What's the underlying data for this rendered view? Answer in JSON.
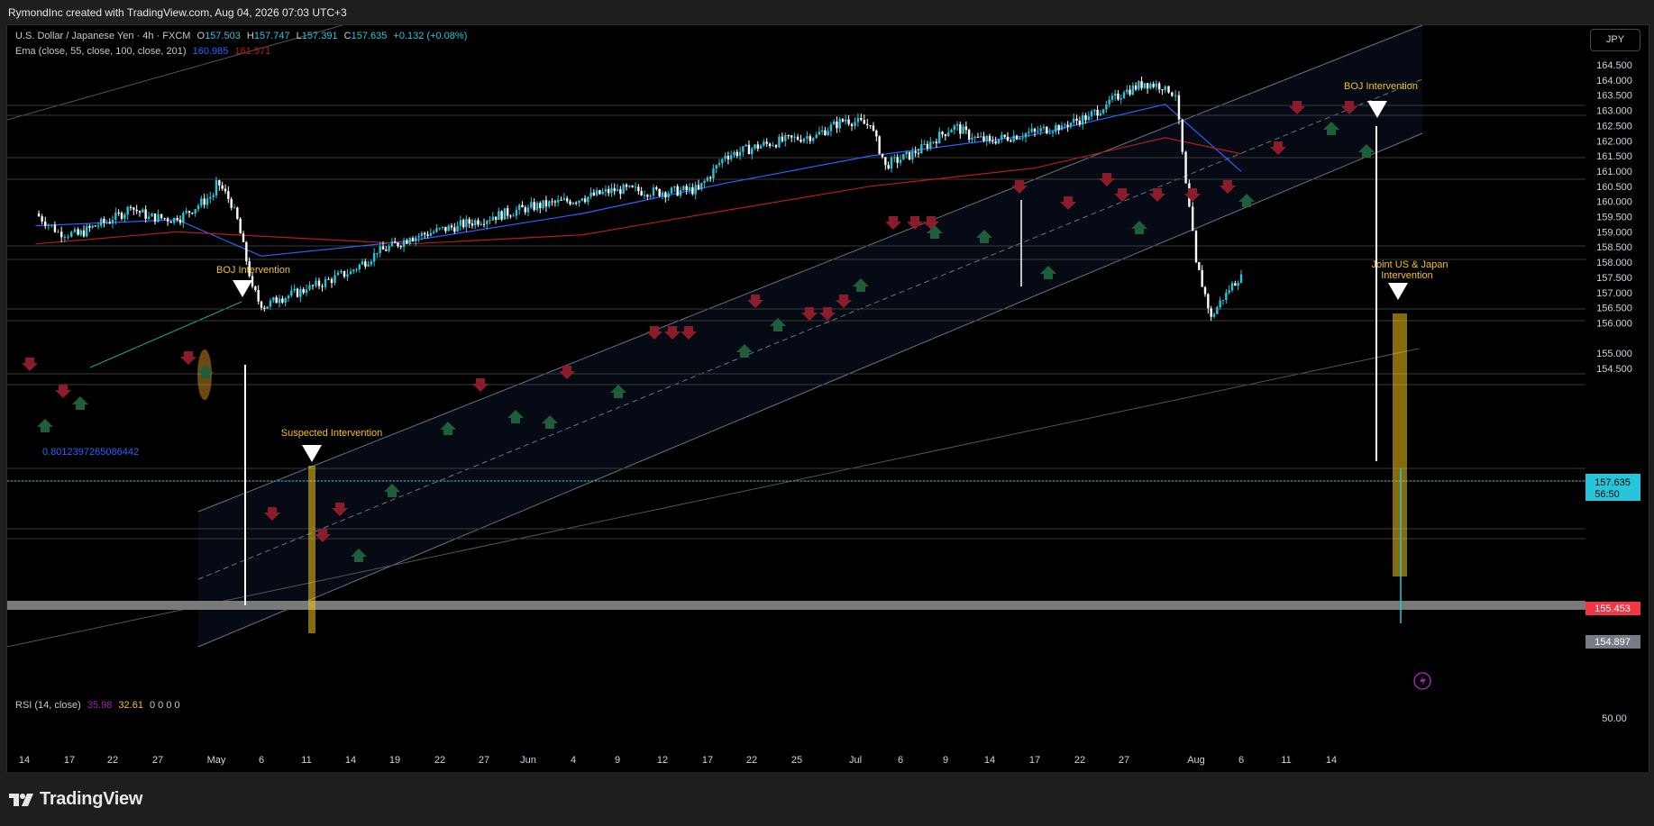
{
  "header": {
    "attribution": "RymondInc created with TradingView.com, Aug 04, 2026 07:03 UTC+3"
  },
  "legend": {
    "symbol": "U.S. Dollar / Japanese Yen · 4h · FXCM",
    "o_label": "O",
    "o_value": "157.503",
    "h_label": "H",
    "h_value": "157.747",
    "l_label": "L",
    "l_value": "157.391",
    "c_label": "C",
    "c_value": "157.635",
    "change": "+0.132 (+0.08%)",
    "ema_label": "Ema (close, 55, close, 100, close, 201)",
    "ema_value_1": "160.985",
    "ema_value_2": "161.571",
    "rsi_label": "RSI (14, close)",
    "rsi_value_1": "35.98",
    "rsi_value_2": "32.61",
    "rsi_zeros": "0  0  0  0"
  },
  "currency_button": "JPY",
  "price_badge": {
    "price": "157.635",
    "countdown": "56:50"
  },
  "level_labels": {
    "support": "155.453",
    "low": "154.897"
  },
  "annotations": {
    "boj_1": "BOJ Intervention",
    "suspected": "Suspected Intervention",
    "boj_2": "BOJ Intervention",
    "joint_line1": "Joint US & Japan",
    "joint_line2": "Intervention",
    "fib_value": "0.8012397265086442"
  },
  "rsi_signals": [
    "Bear",
    "Bear",
    "Bull",
    "Bear",
    "Bear",
    "Bear",
    "Bear",
    "Bull",
    "Bear",
    "Bull"
  ],
  "rsi_axis_label": "50.00",
  "brand": "TradingView",
  "colors": {
    "accent": "#26c6da",
    "bear": "#f23645",
    "bull": "#4caf50",
    "annotation": "#f0c419",
    "ema_fast": "#2962ff",
    "ema_slow": "#b71c1c",
    "background": "#000000"
  },
  "chart_data": {
    "type": "line",
    "title": "U.S. Dollar / Japanese Yen · 4h · FXCM",
    "y_ticks": [
      "164.500",
      "164.000",
      "163.500",
      "163.000",
      "162.500",
      "162.000",
      "161.500",
      "161.000",
      "160.500",
      "160.000",
      "159.500",
      "159.000",
      "158.500",
      "158.000",
      "157.500",
      "157.000",
      "156.500",
      "156.000",
      "155.000",
      "154.500"
    ],
    "ylim": [
      154.2,
      164.9
    ],
    "x_ticks": [
      "14",
      "17",
      "22",
      "27",
      "May",
      "6",
      "11",
      "14",
      "19",
      "22",
      "27",
      "Jun",
      "4",
      "9",
      "12",
      "17",
      "22",
      "25",
      "Jul",
      "6",
      "9",
      "14",
      "17",
      "22",
      "27",
      "Aug",
      "6",
      "11",
      "14"
    ],
    "series": [
      {
        "name": "USDJPY",
        "x": [
          "Apr 14",
          "Apr 16",
          "Apr 18",
          "Apr 20",
          "Apr 22",
          "Apr 24",
          "Apr 26",
          "Apr 28",
          "Apr 30",
          "May 1",
          "May 3",
          "May 5",
          "May 6",
          "May 8",
          "May 11",
          "May 14",
          "May 17",
          "May 20",
          "May 24",
          "May 28",
          "Jun 1",
          "Jun 5",
          "Jun 9",
          "Jun 12",
          "Jun 16",
          "Jun 19",
          "Jun 23",
          "Jun 27",
          "Jun 30",
          "Jul 2",
          "Jul 3",
          "Jul 5",
          "Jul 8",
          "Jul 10",
          "Jul 12",
          "Jul 15",
          "Jul 18",
          "Jul 21",
          "Jul 23",
          "Jul 25",
          "Jul 27",
          "Jul 29",
          "Jul 30",
          "Jul 31",
          "Aug 1",
          "Aug 2",
          "Aug 3",
          "Aug 4"
        ],
        "values": [
          159.6,
          159.0,
          158.9,
          159.2,
          159.4,
          159.8,
          159.5,
          159.4,
          160.3,
          160.7,
          159.8,
          157.2,
          156.5,
          156.8,
          157.1,
          157.7,
          158.3,
          158.8,
          159.2,
          159.5,
          159.8,
          160.1,
          160.4,
          160.3,
          160.4,
          161.5,
          161.9,
          162.2,
          162.7,
          162.5,
          161.2,
          161.6,
          162.5,
          162.1,
          162.0,
          162.3,
          162.5,
          162.8,
          163.2,
          163.6,
          163.9,
          163.8,
          163.5,
          160.6,
          158.0,
          156.2,
          157.0,
          157.6
        ]
      },
      {
        "name": "EMA 55",
        "x": [
          "Apr 14",
          "Apr 28",
          "May 6",
          "May 20",
          "Jun 5",
          "Jun 19",
          "Jul 2",
          "Jul 15",
          "Jul 29",
          "Aug 4"
        ],
        "values": [
          159.2,
          159.4,
          158.2,
          158.7,
          159.6,
          160.6,
          161.5,
          162.2,
          163.2,
          160.99
        ]
      },
      {
        "name": "EMA 100",
        "x": [
          "Apr 14",
          "Apr 28",
          "May 20",
          "Jun 5",
          "Jun 19",
          "Jul 2",
          "Jul 15",
          "Jul 29",
          "Aug 4"
        ],
        "values": [
          158.6,
          159.0,
          158.6,
          158.9,
          159.7,
          160.5,
          161.1,
          162.1,
          161.57
        ]
      }
    ],
    "grid": false,
    "legend_position": "top-left"
  }
}
